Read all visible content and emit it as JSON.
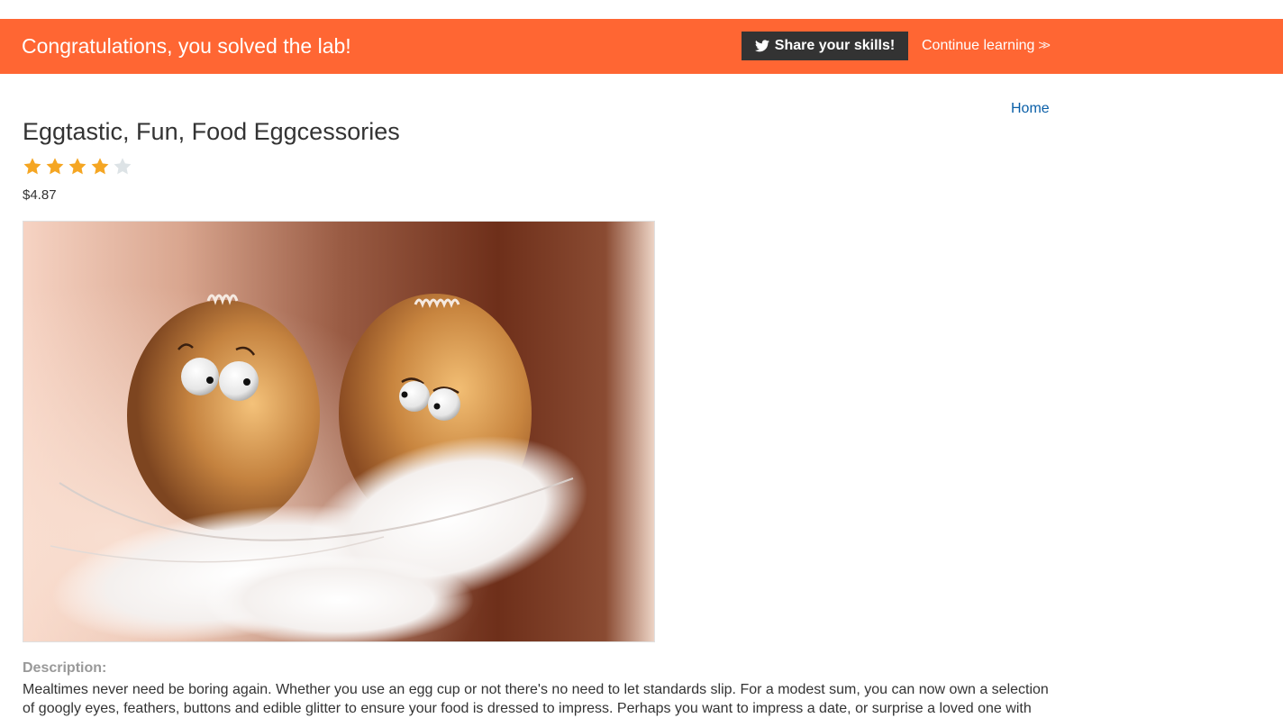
{
  "banner": {
    "message": "Congratulations, you solved the lab!",
    "share_label": "Share your skills!",
    "share_icon": "twitter-icon",
    "continue_label": "Continue learning",
    "continue_icon": "double-chevron-right-icon",
    "background_color": "#ff6633"
  },
  "nav": {
    "home_label": "Home"
  },
  "product": {
    "title": "Eggtastic, Fun, Food Eggcessories",
    "rating": 4,
    "rating_max": 5,
    "price": "$4.87",
    "image_subject": "two brown eggs with googly eyes resting on white feathers",
    "description_label": "Description:",
    "description": "Mealtimes never need be boring again. Whether you use an egg cup or not there's no need to let standards slip. For a modest sum, you can now own a selection of googly eyes, feathers, buttons and edible glitter to ensure your food is dressed to impress. Perhaps you want to impress a date, or surprise a loved one with"
  },
  "colors": {
    "accent": "#ff6633",
    "link": "#0a5fa8",
    "star_filled": "#f5a623",
    "star_empty": "#dde3e6"
  }
}
